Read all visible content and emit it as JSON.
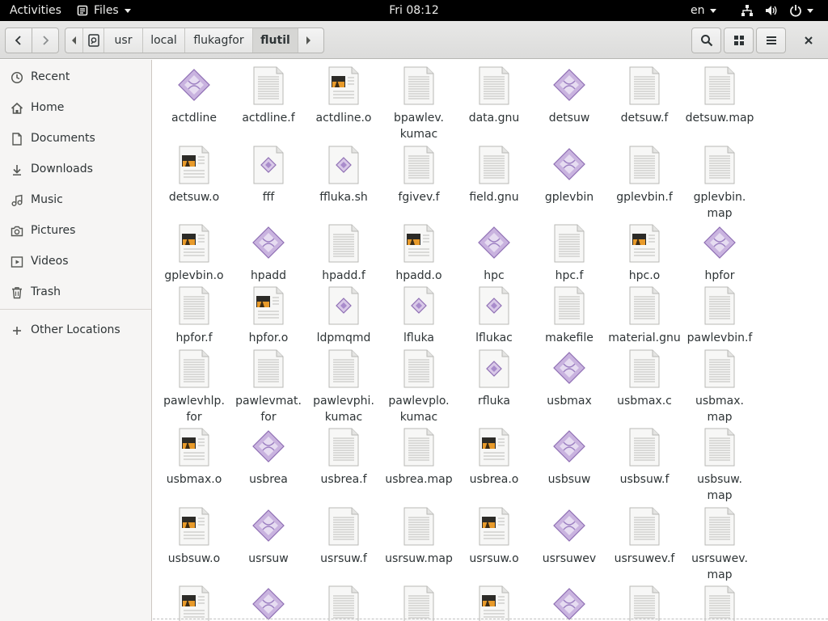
{
  "topbar": {
    "activities": "Activities",
    "app_menu": "Files",
    "clock": "Fri 08:12",
    "language": "en"
  },
  "header": {
    "path": [
      "usr",
      "local",
      "flukagfor",
      "flutil"
    ],
    "active_crumb": "flutil"
  },
  "sidebar": {
    "items": [
      {
        "label": "Recent",
        "icon": "clock-icon"
      },
      {
        "label": "Home",
        "icon": "home-icon"
      },
      {
        "label": "Documents",
        "icon": "document-icon"
      },
      {
        "label": "Downloads",
        "icon": "download-icon"
      },
      {
        "label": "Music",
        "icon": "music-icon"
      },
      {
        "label": "Pictures",
        "icon": "camera-icon"
      },
      {
        "label": "Videos",
        "icon": "video-icon"
      },
      {
        "label": "Trash",
        "icon": "trash-icon"
      }
    ],
    "other_locations": "Other Locations"
  },
  "files": [
    {
      "name": "actdline",
      "type": "exec"
    },
    {
      "name": "actdline.f",
      "type": "text"
    },
    {
      "name": "actdline.o",
      "type": "object"
    },
    {
      "name": "bpawlev.\nkumac",
      "type": "text"
    },
    {
      "name": "data.gnu",
      "type": "text"
    },
    {
      "name": "detsuw",
      "type": "exec"
    },
    {
      "name": "detsuw.f",
      "type": "text"
    },
    {
      "name": "detsuw.map",
      "type": "text"
    },
    {
      "name": "detsuw.o",
      "type": "object"
    },
    {
      "name": "fff",
      "type": "script"
    },
    {
      "name": "ffluka.sh",
      "type": "script"
    },
    {
      "name": "fgivev.f",
      "type": "text"
    },
    {
      "name": "field.gnu",
      "type": "text"
    },
    {
      "name": "gplevbin",
      "type": "exec"
    },
    {
      "name": "gplevbin.f",
      "type": "text"
    },
    {
      "name": "gplevbin.\nmap",
      "type": "text"
    },
    {
      "name": "gplevbin.o",
      "type": "object"
    },
    {
      "name": "hpadd",
      "type": "exec"
    },
    {
      "name": "hpadd.f",
      "type": "text"
    },
    {
      "name": "hpadd.o",
      "type": "object"
    },
    {
      "name": "hpc",
      "type": "exec"
    },
    {
      "name": "hpc.f",
      "type": "text"
    },
    {
      "name": "hpc.o",
      "type": "object"
    },
    {
      "name": "hpfor",
      "type": "exec"
    },
    {
      "name": "hpfor.f",
      "type": "text"
    },
    {
      "name": "hpfor.o",
      "type": "object"
    },
    {
      "name": "ldpmqmd",
      "type": "script"
    },
    {
      "name": "lfluka",
      "type": "script"
    },
    {
      "name": "lflukac",
      "type": "script"
    },
    {
      "name": "makefile",
      "type": "text"
    },
    {
      "name": "material.gnu",
      "type": "text"
    },
    {
      "name": "pawlevbin.f",
      "type": "text"
    },
    {
      "name": "pawlevhlp.\nfor",
      "type": "text"
    },
    {
      "name": "pawlevmat.\nfor",
      "type": "text"
    },
    {
      "name": "pawlevphi.\nkumac",
      "type": "text"
    },
    {
      "name": "pawlevplo.\nkumac",
      "type": "text"
    },
    {
      "name": "rfluka",
      "type": "script"
    },
    {
      "name": "usbmax",
      "type": "exec"
    },
    {
      "name": "usbmax.c",
      "type": "text"
    },
    {
      "name": "usbmax.\nmap",
      "type": "text"
    },
    {
      "name": "usbmax.o",
      "type": "object"
    },
    {
      "name": "usbrea",
      "type": "exec"
    },
    {
      "name": "usbrea.f",
      "type": "text"
    },
    {
      "name": "usbrea.map",
      "type": "text"
    },
    {
      "name": "usbrea.o",
      "type": "object"
    },
    {
      "name": "usbsuw",
      "type": "exec"
    },
    {
      "name": "usbsuw.f",
      "type": "text"
    },
    {
      "name": "usbsuw.\nmap",
      "type": "text"
    },
    {
      "name": "usbsuw.o",
      "type": "object"
    },
    {
      "name": "usrsuw",
      "type": "exec"
    },
    {
      "name": "usrsuw.f",
      "type": "text"
    },
    {
      "name": "usrsuw.map",
      "type": "text"
    },
    {
      "name": "usrsuw.o",
      "type": "object"
    },
    {
      "name": "usrsuwev",
      "type": "exec"
    },
    {
      "name": "usrsuwev.f",
      "type": "text"
    },
    {
      "name": "usrsuwev.\nmap",
      "type": "text"
    },
    {
      "name": "",
      "type": "object"
    },
    {
      "name": "",
      "type": "exec"
    },
    {
      "name": "",
      "type": "text"
    },
    {
      "name": "",
      "type": "text"
    },
    {
      "name": "",
      "type": "object"
    },
    {
      "name": "",
      "type": "exec"
    },
    {
      "name": "",
      "type": "text"
    },
    {
      "name": "",
      "type": "text"
    }
  ]
}
